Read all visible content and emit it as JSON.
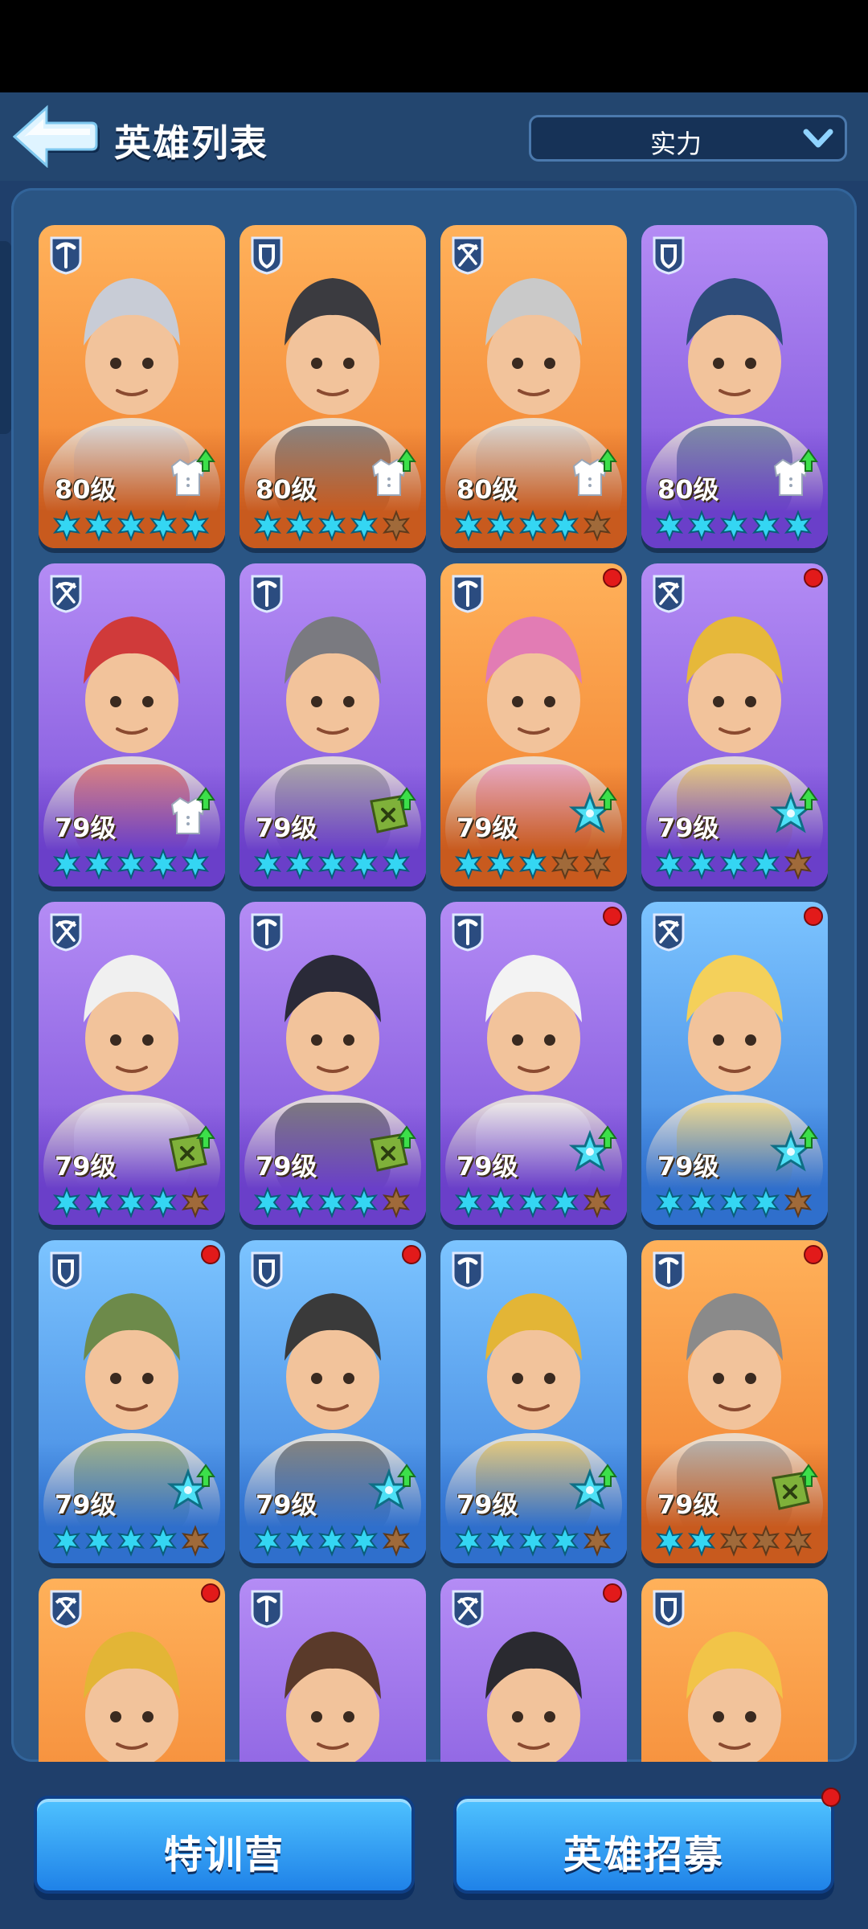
{
  "header": {
    "title": "英雄列表",
    "sort_label": "实力"
  },
  "colors": {
    "orange_bg": "#f28a33",
    "purple_bg": "#8b5fe0",
    "blue_bg": "#3f8fe2",
    "star_on": "#34d6f3",
    "star_off": "#a06a3a",
    "notify_dot": "#e21a1a"
  },
  "heroes": [
    {
      "level": "80级",
      "role": "pickaxe",
      "bg": "orange",
      "stars": 5,
      "upgrade": "coat",
      "notify": false,
      "hair": "#c8ccd6"
    },
    {
      "level": "80级",
      "role": "shield",
      "bg": "orange",
      "stars": 4,
      "upgrade": "coat",
      "notify": false,
      "hair": "#3b3b40"
    },
    {
      "level": "80级",
      "role": "crossbow",
      "bg": "orange",
      "stars": 4,
      "upgrade": "coat",
      "notify": false,
      "hair": "#c9c9c9"
    },
    {
      "level": "80级",
      "role": "shield",
      "bg": "purple",
      "stars": 5,
      "upgrade": "coat",
      "notify": false,
      "hair": "#2e4d7a"
    },
    {
      "level": "79级",
      "role": "crossbow",
      "bg": "purple",
      "stars": 5,
      "upgrade": "coat",
      "notify": false,
      "hair": "#d03a3a"
    },
    {
      "level": "79级",
      "role": "pickaxe",
      "bg": "purple",
      "stars": 5,
      "upgrade": "book",
      "notify": false,
      "hair": "#7a7a80"
    },
    {
      "level": "79级",
      "role": "pickaxe",
      "bg": "orange",
      "stars": 3,
      "upgrade": "snowflake",
      "notify": true,
      "hair": "#e27cb4"
    },
    {
      "level": "79级",
      "role": "crossbow",
      "bg": "purple",
      "stars": 4,
      "upgrade": "snowflake",
      "notify": true,
      "hair": "#e6b83a"
    },
    {
      "level": "79级",
      "role": "crossbow",
      "bg": "purple",
      "stars": 4,
      "upgrade": "book",
      "notify": false,
      "hair": "#f0f0f0"
    },
    {
      "level": "79级",
      "role": "pickaxe",
      "bg": "purple",
      "stars": 4,
      "upgrade": "book",
      "notify": false,
      "hair": "#2a2a38"
    },
    {
      "level": "79级",
      "role": "pickaxe",
      "bg": "purple",
      "stars": 4,
      "upgrade": "snowflake",
      "notify": true,
      "hair": "#f3f3f3"
    },
    {
      "level": "79级",
      "role": "crossbow",
      "bg": "blue",
      "stars": 4,
      "upgrade": "snowflake",
      "notify": true,
      "hair": "#f4d05a"
    },
    {
      "level": "79级",
      "role": "shield",
      "bg": "blue",
      "stars": 4,
      "upgrade": "snowflake",
      "notify": true,
      "hair": "#6d8a4a"
    },
    {
      "level": "79级",
      "role": "shield",
      "bg": "blue",
      "stars": 4,
      "upgrade": "snowflake",
      "notify": true,
      "hair": "#3a3a3a"
    },
    {
      "level": "79级",
      "role": "pickaxe",
      "bg": "blue",
      "stars": 4,
      "upgrade": "snowflake",
      "notify": false,
      "hair": "#e3b536"
    },
    {
      "level": "79级",
      "role": "pickaxe",
      "bg": "orange",
      "stars": 2,
      "upgrade": "book",
      "notify": true,
      "hair": "#8a8a8a"
    },
    {
      "level": "",
      "role": "crossbow",
      "bg": "orange",
      "stars": 0,
      "upgrade": "",
      "notify": true,
      "hair": "#e3b536"
    },
    {
      "level": "",
      "role": "pickaxe",
      "bg": "purple",
      "stars": 0,
      "upgrade": "",
      "notify": false,
      "hair": "#5a3a2a"
    },
    {
      "level": "",
      "role": "crossbow",
      "bg": "purple",
      "stars": 0,
      "upgrade": "",
      "notify": true,
      "hair": "#2a2a30"
    },
    {
      "level": "",
      "role": "shield",
      "bg": "orange",
      "stars": 0,
      "upgrade": "",
      "notify": false,
      "hair": "#f2c448"
    }
  ],
  "buttons": {
    "training": "特训营",
    "recruit": "英雄招募"
  }
}
